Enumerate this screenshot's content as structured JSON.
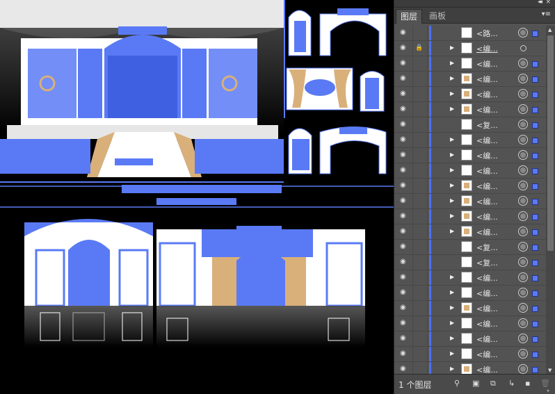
{
  "panel": {
    "tabs": [
      {
        "label": "图层"
      },
      {
        "label": "画板"
      }
    ],
    "collapse_glyph": "◂◂",
    "close_glyph": "×",
    "menu_glyph": "▾≡",
    "layer_count_label": "1 个图层",
    "layers": [
      {
        "name": "<路...",
        "lock": false,
        "expand": false,
        "thumb": "white",
        "target": "filled",
        "selected": true,
        "underline": false
      },
      {
        "name": "<编...",
        "lock": true,
        "expand": true,
        "thumb": "white",
        "target": "small",
        "selected": false,
        "underline": true
      },
      {
        "name": "<编...",
        "lock": false,
        "expand": true,
        "thumb": "white",
        "target": "filled",
        "selected": true,
        "underline": false
      },
      {
        "name": "<编...",
        "lock": false,
        "expand": true,
        "thumb": "gold",
        "target": "filled",
        "selected": true,
        "underline": false
      },
      {
        "name": "<编...",
        "lock": false,
        "expand": true,
        "thumb": "gold",
        "target": "filled",
        "selected": true,
        "underline": false
      },
      {
        "name": "<编...",
        "lock": false,
        "expand": true,
        "thumb": "gold",
        "target": "filled",
        "selected": true,
        "underline": false
      },
      {
        "name": "<复...",
        "lock": false,
        "expand": false,
        "thumb": "white",
        "target": "filled",
        "selected": true,
        "underline": false
      },
      {
        "name": "<编...",
        "lock": false,
        "expand": true,
        "thumb": "white",
        "target": "filled",
        "selected": true,
        "underline": false
      },
      {
        "name": "<编...",
        "lock": false,
        "expand": true,
        "thumb": "white",
        "target": "filled",
        "selected": true,
        "underline": false
      },
      {
        "name": "<编...",
        "lock": false,
        "expand": true,
        "thumb": "white",
        "target": "filled",
        "selected": true,
        "underline": false
      },
      {
        "name": "<编...",
        "lock": false,
        "expand": true,
        "thumb": "gold",
        "target": "filled",
        "selected": true,
        "underline": false
      },
      {
        "name": "<编...",
        "lock": false,
        "expand": true,
        "thumb": "gold",
        "target": "filled",
        "selected": true,
        "underline": false
      },
      {
        "name": "<编...",
        "lock": false,
        "expand": true,
        "thumb": "gold",
        "target": "filled",
        "selected": true,
        "underline": false
      },
      {
        "name": "<编...",
        "lock": false,
        "expand": true,
        "thumb": "gold",
        "target": "filled",
        "selected": true,
        "underline": false
      },
      {
        "name": "<复...",
        "lock": false,
        "expand": false,
        "thumb": "white",
        "target": "filled",
        "selected": true,
        "underline": false
      },
      {
        "name": "<复...",
        "lock": false,
        "expand": false,
        "thumb": "white",
        "target": "filled",
        "selected": true,
        "underline": false
      },
      {
        "name": "<编...",
        "lock": false,
        "expand": true,
        "thumb": "white",
        "target": "filled",
        "selected": true,
        "underline": false
      },
      {
        "name": "<编...",
        "lock": false,
        "expand": true,
        "thumb": "white",
        "target": "filled",
        "selected": true,
        "underline": false
      },
      {
        "name": "<编...",
        "lock": false,
        "expand": true,
        "thumb": "gold",
        "target": "filled",
        "selected": true,
        "underline": false
      },
      {
        "name": "<编...",
        "lock": false,
        "expand": true,
        "thumb": "white",
        "target": "filled",
        "selected": true,
        "underline": false
      },
      {
        "name": "<编...",
        "lock": false,
        "expand": true,
        "thumb": "white",
        "target": "filled",
        "selected": true,
        "underline": false
      },
      {
        "name": "<编...",
        "lock": false,
        "expand": true,
        "thumb": "white",
        "target": "filled",
        "selected": true,
        "underline": false
      },
      {
        "name": "<编...",
        "lock": false,
        "expand": true,
        "thumb": "gold",
        "target": "filled",
        "selected": true,
        "underline": false
      },
      {
        "name": "<编...",
        "lock": false,
        "expand": true,
        "thumb": "white",
        "target": "filled",
        "selected": true,
        "underline": false
      }
    ],
    "bottom_icons": [
      "search-icon",
      "locate-object-icon",
      "make-clipping-mask-icon",
      "new-sublayer-icon",
      "new-layer-icon",
      "delete-icon"
    ]
  },
  "colors": {
    "selection_blue": "#5a7af5",
    "canvas_bg": "#000000",
    "panel_bg": "#535353",
    "gold": "#d9b07a"
  }
}
